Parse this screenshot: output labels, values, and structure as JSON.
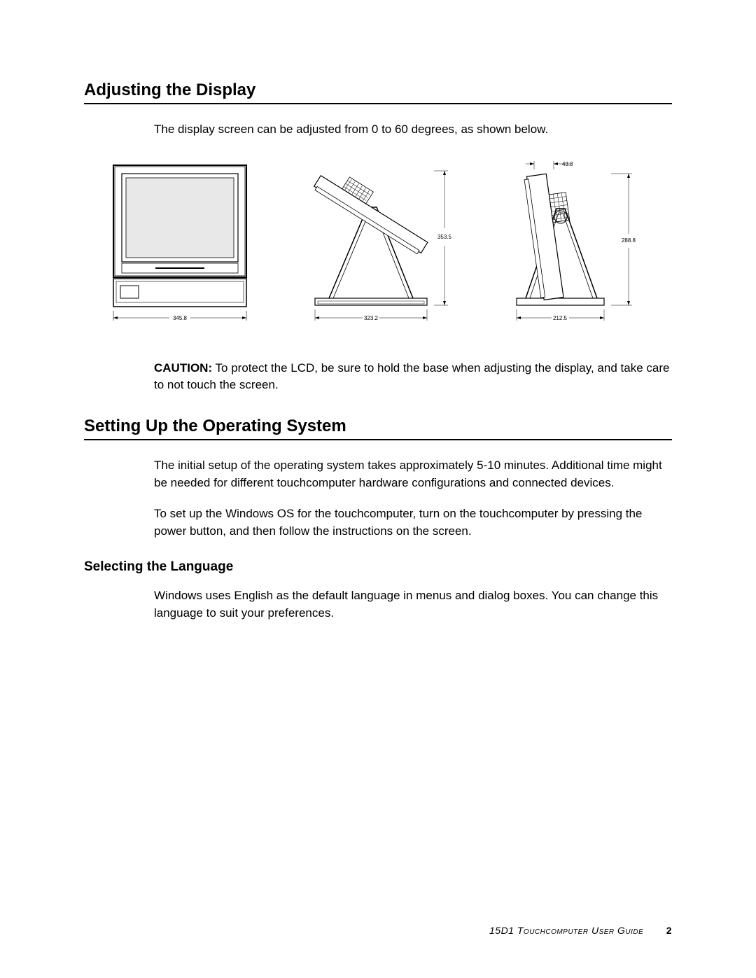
{
  "section1": {
    "heading": "Adjusting the Display",
    "intro": "The display screen can be adjusted from 0 to 60 degrees, as shown below.",
    "caution_label": "CAUTION:",
    "caution_text": "  To protect the LCD, be sure to hold the base when adjusting the display, and take care to not touch the screen."
  },
  "figure": {
    "dims": {
      "front_width": "345.8",
      "side60_width": "323.2",
      "side60_height": "353.5",
      "side0_width": "212.5",
      "side0_height": "288.8",
      "top_depth": "43.8"
    }
  },
  "section2": {
    "heading": "Setting Up the Operating System",
    "para1": "The initial setup of the operating system takes approximately 5-10 minutes. Additional time might be needed for different touchcomputer hardware configurations and connected devices.",
    "para2": "To set up the Windows OS for the touchcomputer, turn on the touchcomputer by pressing the power button, and then follow the instructions on the screen.",
    "sub_heading": "Selecting the Language",
    "para3": "Windows uses English as the default language in menus and dialog boxes. You can change this language to suit your preferences."
  },
  "footer": {
    "title": "15D1 Touchcomputer User Guide",
    "page": "2"
  }
}
